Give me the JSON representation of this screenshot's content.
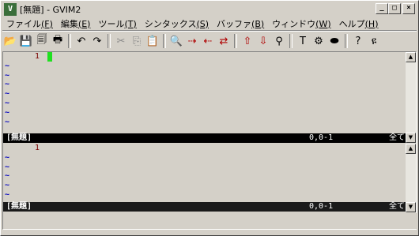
{
  "window": {
    "title": "[無題] - GVIM2",
    "app_icon_text": "V",
    "controls": {
      "minimize": "_",
      "maximize": "□",
      "close": "×"
    }
  },
  "menu": [
    {
      "label": "ファイル",
      "acc": "(F)"
    },
    {
      "label": "編集",
      "acc": "(E)"
    },
    {
      "label": "ツール",
      "acc": "(T)"
    },
    {
      "label": "シンタックス",
      "acc": "(S)"
    },
    {
      "label": "バッファ",
      "acc": "(B)"
    },
    {
      "label": "ウィンドウ",
      "acc": "(W)"
    },
    {
      "label": "ヘルプ",
      "acc": "(H)"
    }
  ],
  "toolbar": [
    {
      "icon": "open-icon",
      "glyph": "📂"
    },
    {
      "icon": "save-icon",
      "glyph": "💾"
    },
    {
      "icon": "save-all-icon",
      "glyph": "🗐"
    },
    {
      "icon": "print-icon",
      "glyph": "🖶"
    },
    {
      "icon": "separator"
    },
    {
      "icon": "undo-icon",
      "glyph": "↶"
    },
    {
      "icon": "redo-icon",
      "glyph": "↷"
    },
    {
      "icon": "separator"
    },
    {
      "icon": "cut-icon",
      "glyph": "✂"
    },
    {
      "icon": "copy-icon",
      "glyph": "⎘"
    },
    {
      "icon": "paste-icon",
      "glyph": "📋"
    },
    {
      "icon": "separator"
    },
    {
      "icon": "find-icon",
      "glyph": "🔍"
    },
    {
      "icon": "find-next-icon",
      "glyph": "⇢"
    },
    {
      "icon": "find-prev-icon",
      "glyph": "⇠"
    },
    {
      "icon": "replace-icon",
      "glyph": "⇄"
    },
    {
      "icon": "separator"
    },
    {
      "icon": "load-session-icon",
      "glyph": "⇧"
    },
    {
      "icon": "save-session-icon",
      "glyph": "⇩"
    },
    {
      "icon": "run-script-icon",
      "glyph": "⚲"
    },
    {
      "icon": "separator"
    },
    {
      "icon": "make-icon",
      "glyph": "T"
    },
    {
      "icon": "build-tags-icon",
      "glyph": "⚙"
    },
    {
      "icon": "jump-tag-icon",
      "glyph": "⬬"
    },
    {
      "icon": "separator"
    },
    {
      "icon": "help-icon",
      "glyph": "?"
    },
    {
      "icon": "find-help-icon",
      "glyph": "ዩ"
    }
  ],
  "pane1": {
    "lines": [
      {
        "num": "1",
        "cursor": true
      }
    ],
    "tilde_count": 7,
    "status": {
      "name": "[無題]",
      "position": "0,0-1",
      "scroll": "全て"
    }
  },
  "pane2": {
    "lines": [
      {
        "num": "1",
        "cursor": false
      }
    ],
    "tilde_count": 5,
    "status": {
      "name": "[無題]",
      "position": "0,0-1",
      "scroll": "全て"
    }
  },
  "colors": {
    "cursor": "#20e020",
    "tilde": "#0000c0",
    "line_number": "#7a0000",
    "status_bg": "#000000"
  }
}
